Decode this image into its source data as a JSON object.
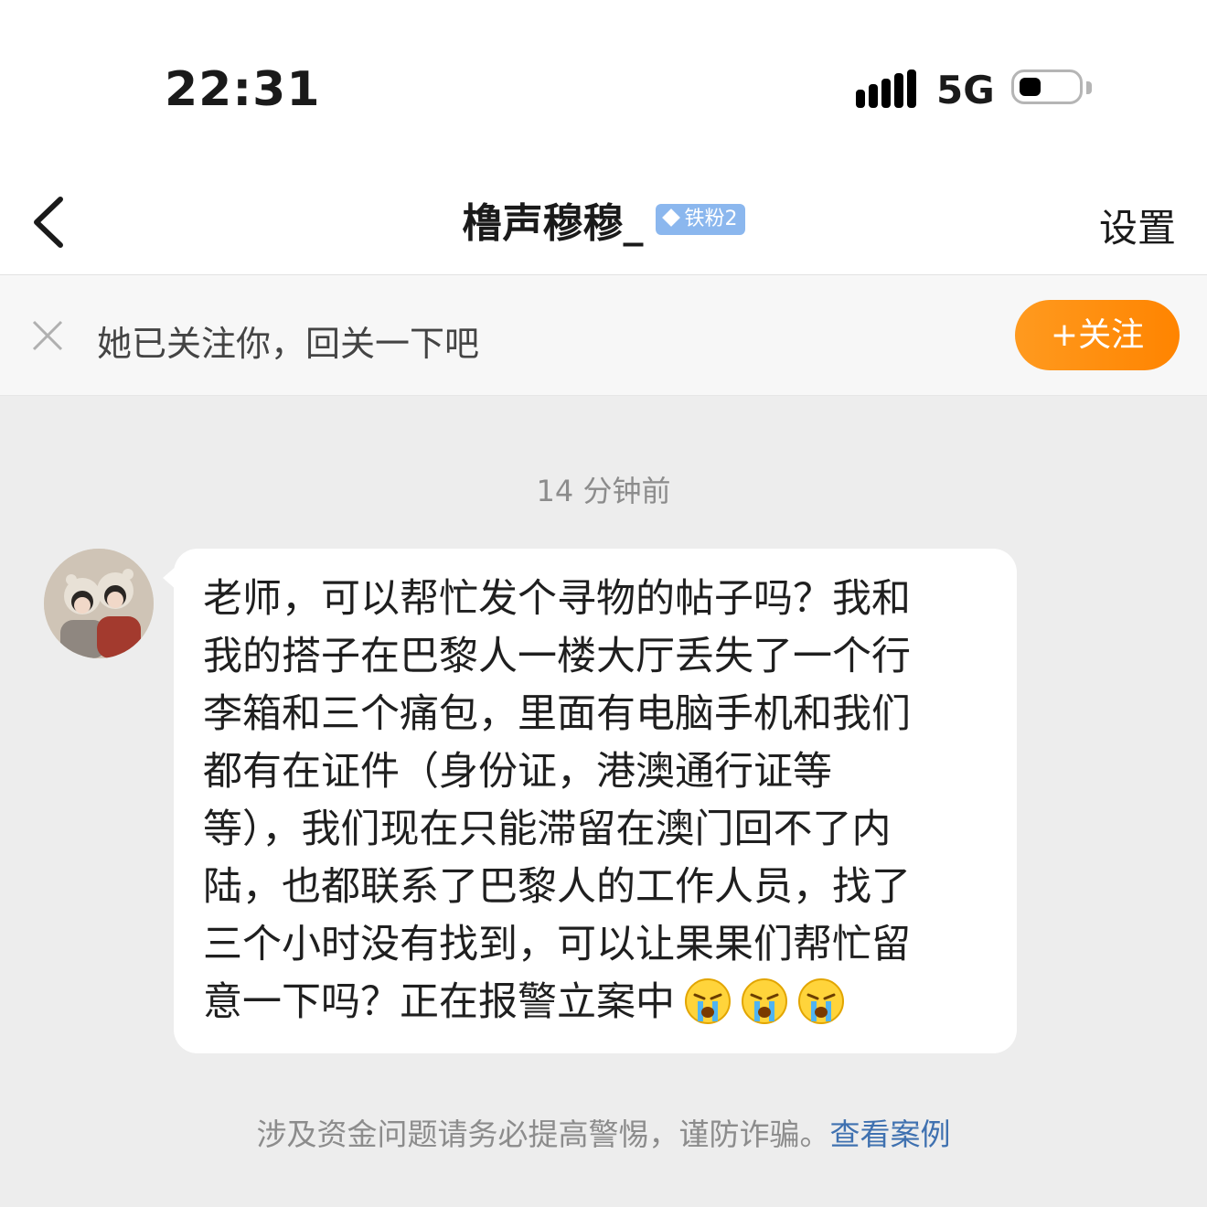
{
  "status": {
    "time": "22:31",
    "network": "5G",
    "battery_level": 0.35
  },
  "header": {
    "title": "橹声穆穆_",
    "fan_badge": "铁粉2",
    "settings_label": "设置"
  },
  "follow_prompt": {
    "text": "她已关注你，回关一下吧",
    "button_label": "+关注"
  },
  "chat": {
    "timestamp": "14 分钟前",
    "messages": [
      {
        "lines": [
          "老师，可以帮忙发个寻物的帖子吗？我和",
          "我的搭子在巴黎人一楼大厅丢失了一个行",
          "李箱和三个痛包，里面有电脑手机和我们",
          "都有在证件（身份证，港澳通行证等",
          "等），我们现在只能滞留在澳门回不了内",
          "陆，也都联系了巴黎人的工作人员，找了",
          "三个小时没有找到，可以让果果们帮忙留",
          "意一下吗？正在报警立案中"
        ],
        "trailing_emoji": [
          "crying-face",
          "crying-face",
          "crying-face"
        ]
      }
    ]
  },
  "footer": {
    "warning": "涉及资金问题请务必提高警惕，谨防诈骗。",
    "link": "查看案例"
  },
  "colors": {
    "accent_orange": "#ff8c0a",
    "link_blue": "#3f71b0",
    "badge_blue": "#8bb7ee"
  }
}
